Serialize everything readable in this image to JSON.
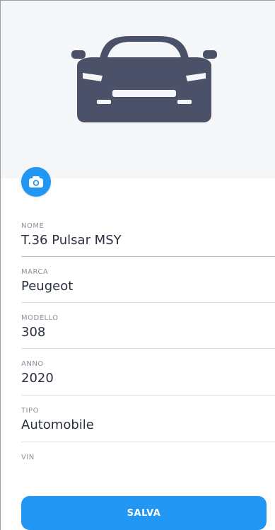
{
  "hero": {
    "image_icon": "car-icon",
    "camera_icon": "camera-icon"
  },
  "fields": [
    {
      "label": "NOME",
      "value": "T.36 Pulsar MSY"
    },
    {
      "label": "MARCA",
      "value": "Peugeot"
    },
    {
      "label": "MODELLO",
      "value": "308"
    },
    {
      "label": "ANNO",
      "value": "2020"
    },
    {
      "label": "TIPO",
      "value": "Automobile"
    },
    {
      "label": "VIN",
      "value": ""
    }
  ],
  "actions": {
    "save_label": "SALVA"
  },
  "colors": {
    "accent": "#2196f3",
    "hero_background": "#f5f6f8",
    "car": "#4b5169"
  }
}
